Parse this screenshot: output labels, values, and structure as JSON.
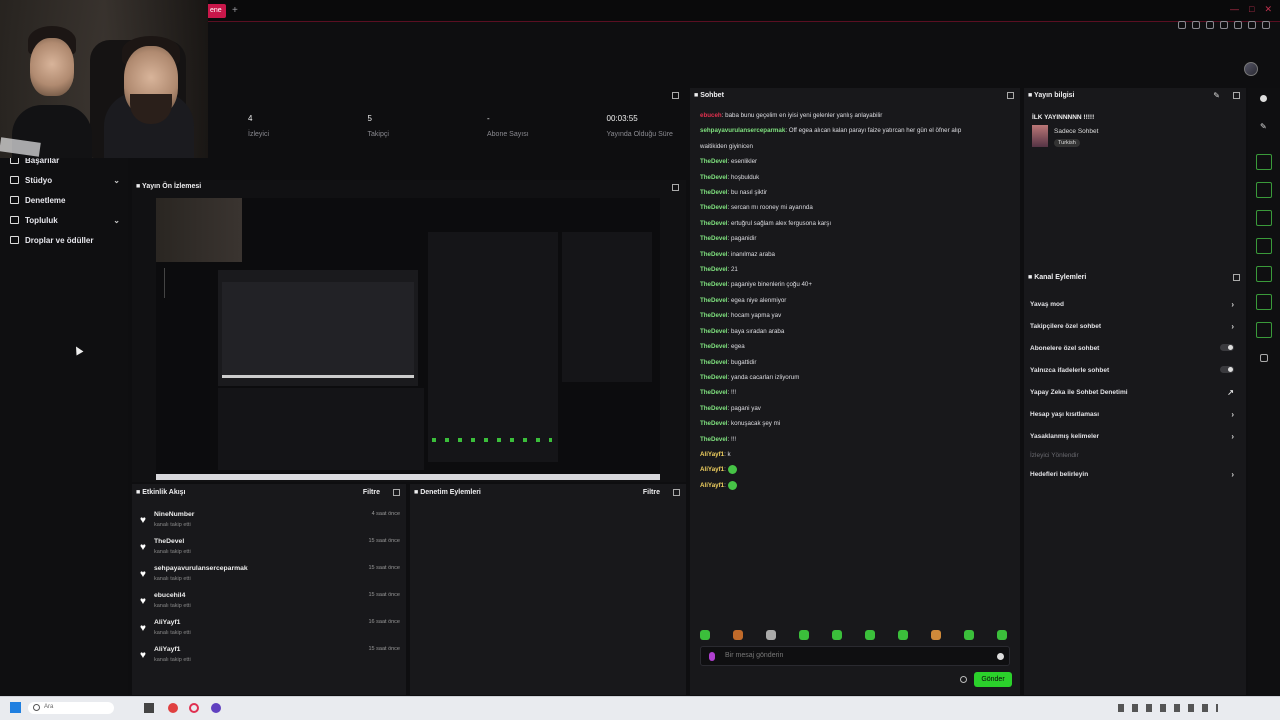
{
  "browser": {
    "tab_label": "ene",
    "new_tab": "+"
  },
  "sidebar": {
    "items": [
      {
        "label": "Başarılar",
        "has_chevron": false
      },
      {
        "label": "Stüdyo",
        "has_chevron": true
      },
      {
        "label": "Denetleme",
        "has_chevron": false
      },
      {
        "label": "Topluluk",
        "has_chevron": true
      },
      {
        "label": "Droplar ve ödüller",
        "has_chevron": false
      }
    ]
  },
  "stats": [
    {
      "value": "4",
      "label": "İzleyici"
    },
    {
      "value": "5",
      "label": "Takipçi"
    },
    {
      "value": "-",
      "label": "Abone Sayısı"
    },
    {
      "value": "00:03:55",
      "label": "Yayında Olduğu Süre"
    }
  ],
  "preview": {
    "title": "Yayın Ön İzlemesi"
  },
  "chat": {
    "title": "Sohbet",
    "messages": [
      {
        "user": "ebuceh",
        "color": "#e0304e",
        "text": "baba bunu geçelim en iyisi yeni gelenler yanlış anlayabilir"
      },
      {
        "user": "sehpayavurulanserceparmak",
        "color": "#7ee07e",
        "text": "Off egea alıcan kalan parayı faize yatırcan her gün el öfner alıp"
      },
      {
        "user": "",
        "color": "",
        "text": "waitikiden giyinicen"
      },
      {
        "user": "TheDevel",
        "color": "#7ee07e",
        "text": "esenlikler"
      },
      {
        "user": "TheDevel",
        "color": "#7ee07e",
        "text": "hoşbulduk"
      },
      {
        "user": "TheDevel",
        "color": "#7ee07e",
        "text": "bu nasıl şiktir"
      },
      {
        "user": "TheDevel",
        "color": "#7ee07e",
        "text": "sercan mı rooney mi ayarında"
      },
      {
        "user": "TheDevel",
        "color": "#7ee07e",
        "text": "ertuğrul sağlam alex fergusona karşı"
      },
      {
        "user": "TheDevel",
        "color": "#7ee07e",
        "text": "paganidir"
      },
      {
        "user": "TheDevel",
        "color": "#7ee07e",
        "text": "inanılmaz araba"
      },
      {
        "user": "TheDevel",
        "color": "#7ee07e",
        "text": "21"
      },
      {
        "user": "TheDevel",
        "color": "#7ee07e",
        "text": "paganiye binenlerin çoğu 40+"
      },
      {
        "user": "TheDevel",
        "color": "#7ee07e",
        "text": "egea niye alenmiyor"
      },
      {
        "user": "TheDevel",
        "color": "#7ee07e",
        "text": "hocam yapma yav"
      },
      {
        "user": "TheDevel",
        "color": "#7ee07e",
        "text": "baya sıradan araba"
      },
      {
        "user": "TheDevel",
        "color": "#7ee07e",
        "text": "egea"
      },
      {
        "user": "TheDevel",
        "color": "#7ee07e",
        "text": "bugattidir"
      },
      {
        "user": "TheDevel",
        "color": "#7ee07e",
        "text": "yanda cacarları izliyorum"
      },
      {
        "user": "TheDevel",
        "color": "#7ee07e",
        "text": "!!!"
      },
      {
        "user": "TheDevel",
        "color": "#7ee07e",
        "text": "pagani yav"
      },
      {
        "user": "TheDevel",
        "color": "#7ee07e",
        "text": "konuşacak şey mi"
      },
      {
        "user": "TheDevel",
        "color": "#7ee07e",
        "text": "!!!"
      },
      {
        "user": "AliYayf1",
        "color": "#f0d060",
        "text": "k"
      },
      {
        "user": "AliYayf1",
        "color": "#f0d060",
        "text": ""
      },
      {
        "user": "AliYayf1",
        "color": "#f0d060",
        "text": ""
      }
    ],
    "input_placeholder": "Bir mesaj gönderin",
    "send_label": "Gönder"
  },
  "stream_info": {
    "title": "Yayın bilgisi",
    "stream_title": "İLK YAYINNNNN !!!!!",
    "mode": "Sadece Sohbet",
    "language": "Turkish"
  },
  "channel_actions": {
    "title": "Kanal Eylemleri",
    "items": [
      {
        "label": "Yavaş mod",
        "control": "chevron"
      },
      {
        "label": "Takipçilere özel sohbet",
        "control": "chevron"
      },
      {
        "label": "Abonelere özel sohbet",
        "control": "toggle"
      },
      {
        "label": "Yalnızca ifadelerle sohbet",
        "control": "toggle"
      },
      {
        "label": "Yapay Zeka ile Sohbet Denetimi",
        "control": "external"
      },
      {
        "label": "Hesap yaşı kısıtlaması",
        "control": "chevron"
      },
      {
        "label": "Yasaklanmış kelimeler",
        "control": "chevron"
      },
      {
        "label": "İzleyici Yönlendir",
        "control": "none",
        "dim": true
      },
      {
        "label": "Hedefleri belirleyin",
        "control": "chevron"
      }
    ]
  },
  "activity": {
    "title": "Etkinlik Akışı",
    "filter": "Filtre",
    "rows": [
      {
        "name": "NineNumber",
        "sub": "kanalı takip etti",
        "time": "4 saat önce"
      },
      {
        "name": "TheDevel",
        "sub": "kanalı takip etti",
        "time": "15 saat önce"
      },
      {
        "name": "sehpayavurulanserceparmak",
        "sub": "kanalı takip etti",
        "time": "15 saat önce"
      },
      {
        "name": "ebucehil4",
        "sub": "kanalı takip etti",
        "time": "15 saat önce"
      },
      {
        "name": "AliYayf1",
        "sub": "kanalı takip etti",
        "time": "16 saat önce"
      },
      {
        "name": "AliYayf1",
        "sub": "kanalı takip etti",
        "time": "15 saat önce"
      }
    ]
  },
  "mod_actions": {
    "title": "Denetim Eylemleri",
    "filter": "Filtre"
  },
  "taskbar": {
    "search_placeholder": "Ara"
  }
}
